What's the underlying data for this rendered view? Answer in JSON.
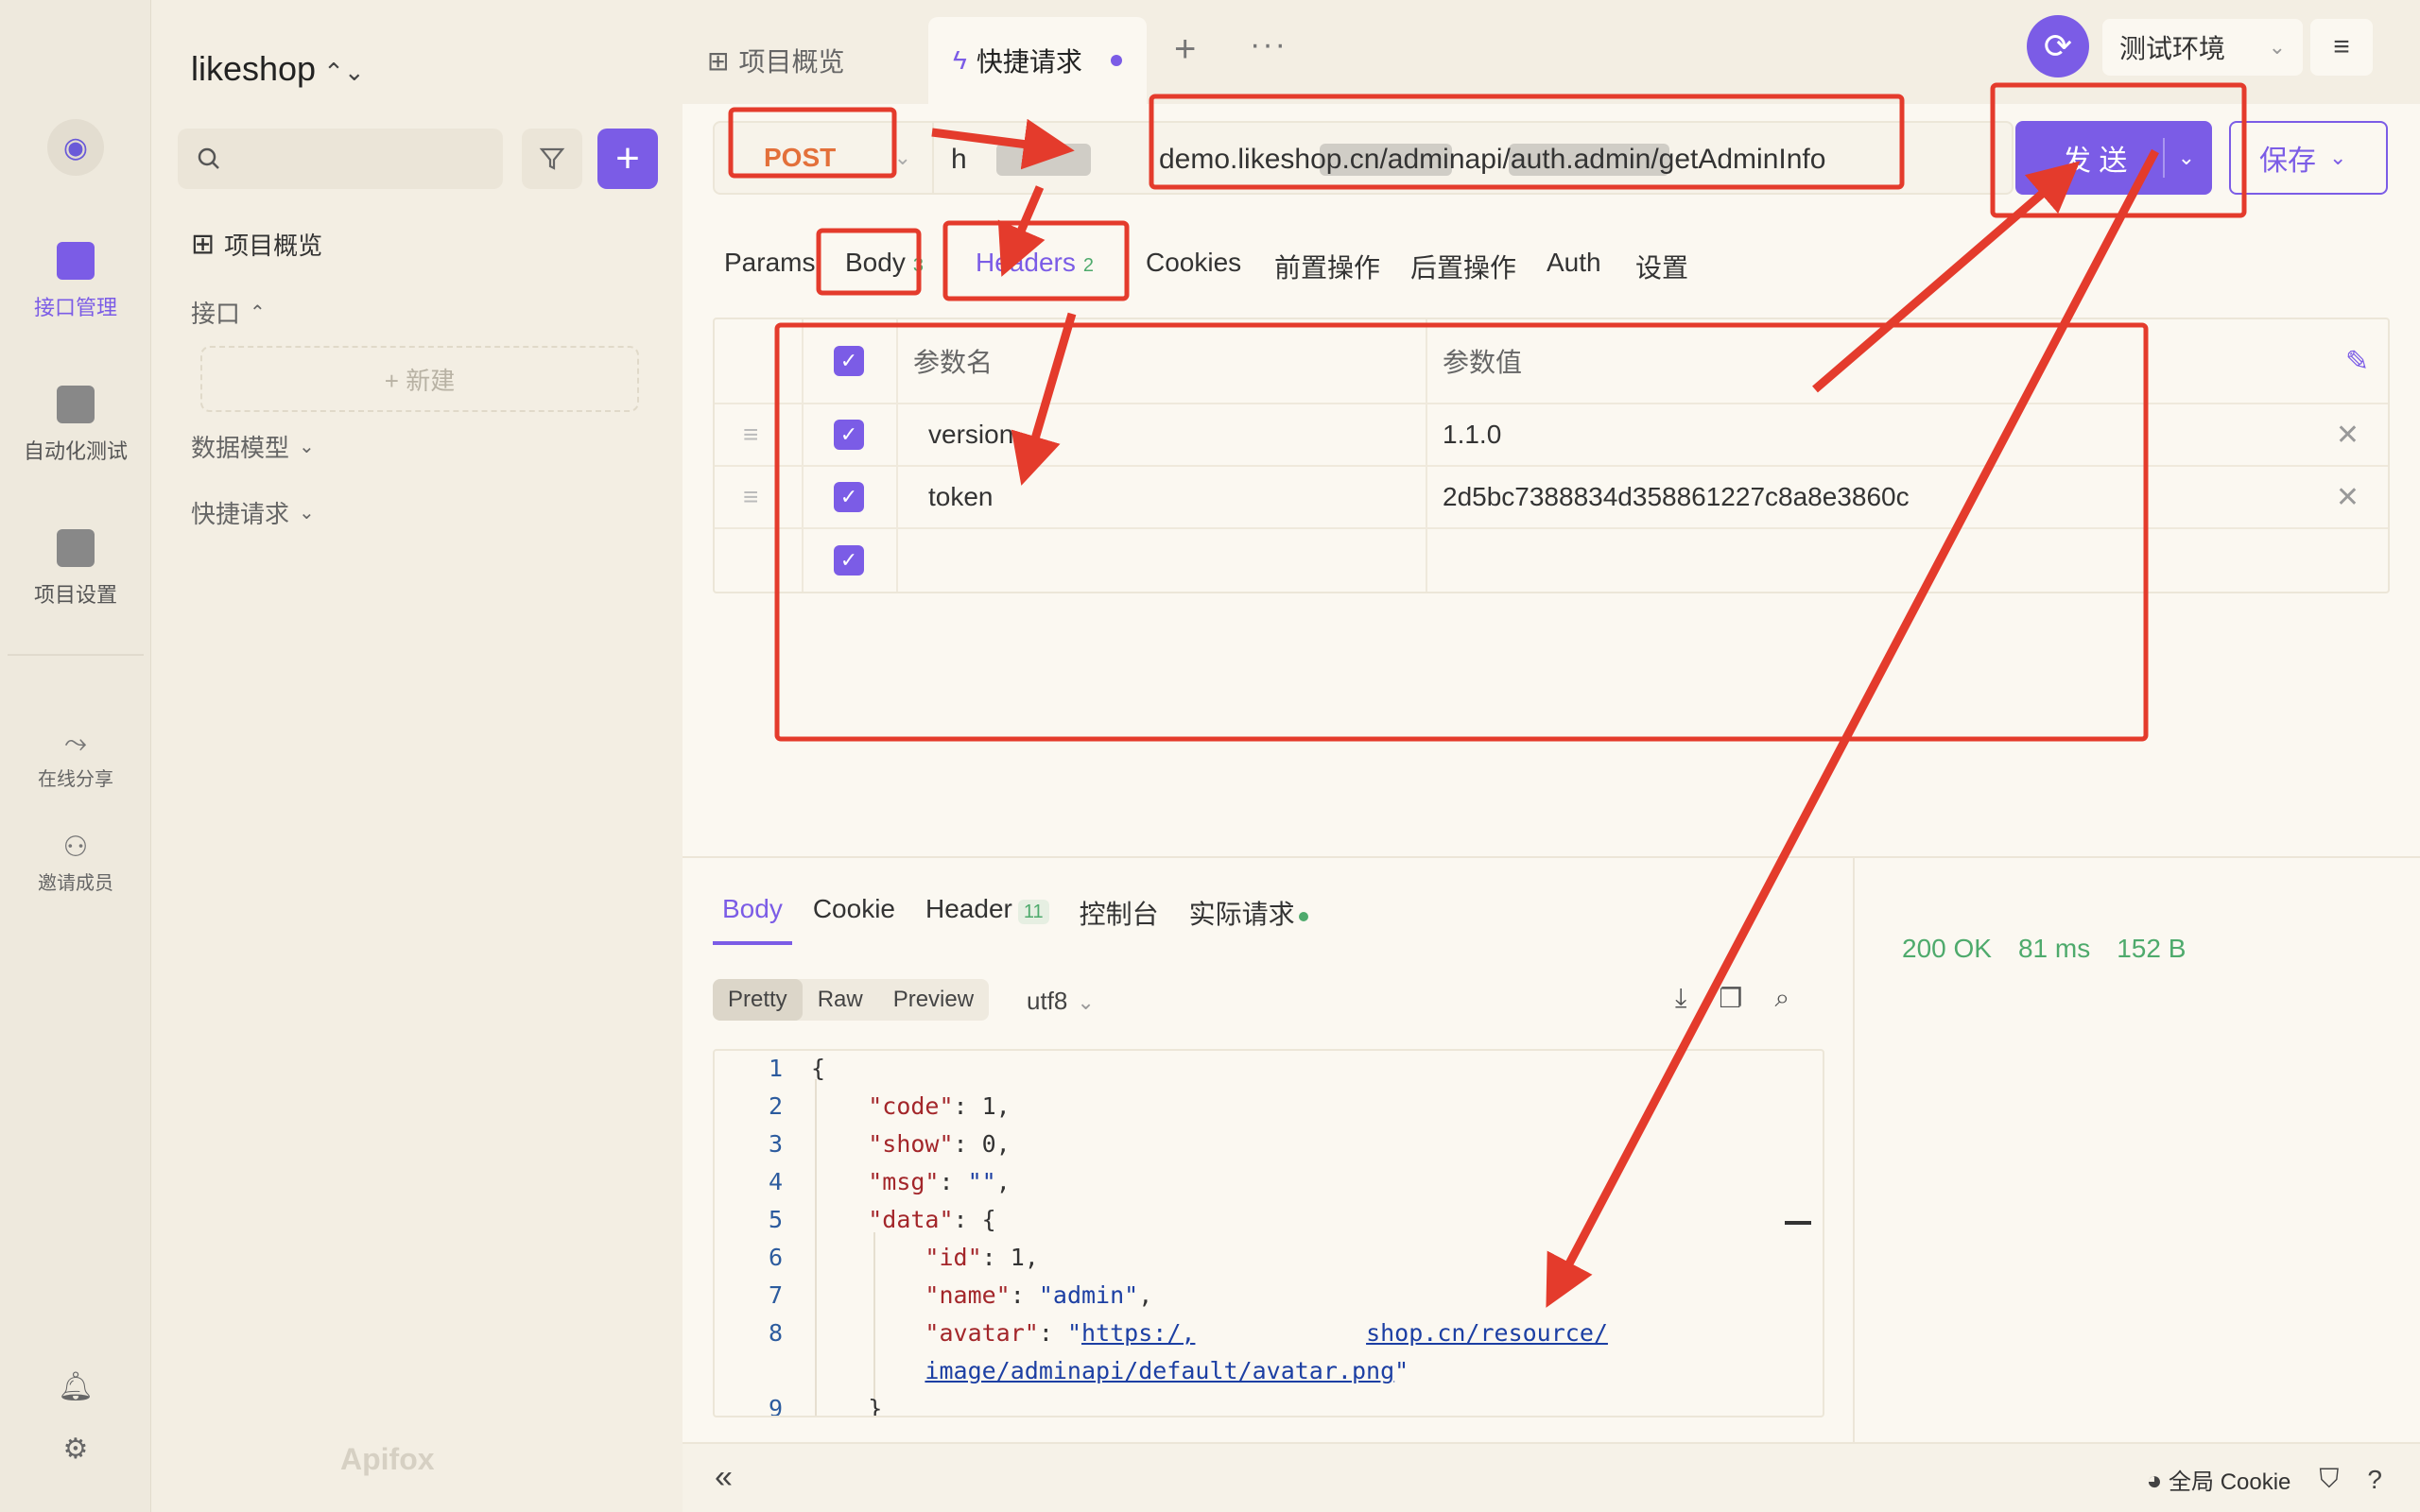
{
  "window": {
    "title": "likeshop"
  },
  "rail": {
    "items": [
      {
        "label": "接口管理",
        "icon": "api-icon",
        "active": true
      },
      {
        "label": "自动化测试",
        "icon": "automation-icon",
        "active": false
      },
      {
        "label": "项目设置",
        "icon": "settings-icon",
        "active": false
      }
    ],
    "share_label": "在线分享",
    "invite_label": "邀请成员"
  },
  "sidebar": {
    "project": "likeshop",
    "search_placeholder": "",
    "overview_label": "项目概览",
    "api_label": "接口",
    "new_label": "+ 新建",
    "models_label": "数据模型",
    "quick_label": "快捷请求",
    "brand": "Apifox"
  },
  "tabs": [
    {
      "label": "项目概览",
      "icon": "grid-icon"
    },
    {
      "label": "快捷请求",
      "icon": "bolt-icon",
      "active": true
    }
  ],
  "env": {
    "name": "测试环境"
  },
  "request": {
    "method": "POST",
    "url": "h",
    "url_visible_tail": "demo.likeshop.cn/adminapi/auth.admin/getAdminInfo",
    "send_label": "发 送",
    "save_label": "保存"
  },
  "request_tabs": {
    "params": "Params",
    "body": "Body",
    "body_count": "3",
    "headers": "Headers",
    "headers_count": "2",
    "cookies": "Cookies",
    "pre": "前置操作",
    "post": "后置操作",
    "auth": "Auth",
    "settings": "设置"
  },
  "headers_table": {
    "col_name": "参数名",
    "col_value": "参数值",
    "rows": [
      {
        "name": "version",
        "value": "1.1.0"
      },
      {
        "name": "token",
        "value": "2d5bc7388834d358861227c8a8e3860c"
      },
      {
        "name": "",
        "value": ""
      }
    ]
  },
  "response": {
    "tabs": {
      "body": "Body",
      "cookie": "Cookie",
      "header": "Header",
      "header_count": "11",
      "console": "控制台",
      "actual": "实际请求"
    },
    "status": "200 OK",
    "time": "81 ms",
    "size": "152 B",
    "formats": [
      "Pretty",
      "Raw",
      "Preview"
    ],
    "encoding": "utf8",
    "line_numbers": [
      "1",
      "2",
      "3",
      "4",
      "5",
      "6",
      "7",
      "8",
      "",
      "9"
    ]
  },
  "footer": {
    "cookie_label": "全局 Cookie"
  },
  "colors": {
    "accent": "#7b5ce6",
    "annotation": "#e43b2c",
    "success": "#4eaa6c"
  }
}
